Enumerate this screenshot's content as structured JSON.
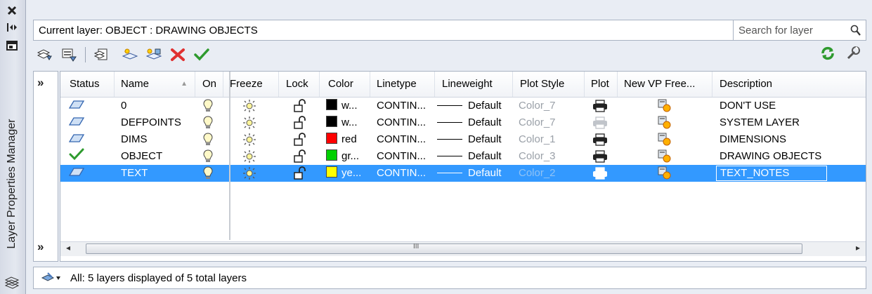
{
  "palette": {
    "title": "Layer Properties Manager"
  },
  "header": {
    "current_layer": "Current layer: OBJECT : DRAWING OBJECTS",
    "search_placeholder": "Search for layer"
  },
  "tree": {
    "expand_glyph": "»",
    "expand_glyph_bottom": "»"
  },
  "columns": [
    "Status",
    "Name",
    "On",
    "Freeze",
    "Lock",
    "Color",
    "Linetype",
    "Lineweight",
    "Plot Style",
    "Plot",
    "New VP Free...",
    "Description"
  ],
  "layers": [
    {
      "name": "0",
      "color_label": "w...",
      "color_hex": "#000000",
      "linetype": "CONTIN...",
      "lineweight": "Default",
      "plot_style": "Color_7",
      "description": "DON'T USE",
      "status": "layer",
      "plot_enabled": true
    },
    {
      "name": "DEFPOINTS",
      "color_label": "w...",
      "color_hex": "#000000",
      "linetype": "CONTIN...",
      "lineweight": "Default",
      "plot_style": "Color_7",
      "description": "SYSTEM LAYER",
      "status": "layer",
      "plot_enabled": false
    },
    {
      "name": "DIMS",
      "color_label": "red",
      "color_hex": "#ff0000",
      "linetype": "CONTIN...",
      "lineweight": "Default",
      "plot_style": "Color_1",
      "description": "DIMENSIONS",
      "status": "layer",
      "plot_enabled": true
    },
    {
      "name": "OBJECT",
      "color_label": "gr...",
      "color_hex": "#00d000",
      "linetype": "CONTIN...",
      "lineweight": "Default",
      "plot_style": "Color_3",
      "description": "DRAWING OBJECTS",
      "status": "current",
      "plot_enabled": true
    },
    {
      "name": "TEXT",
      "color_label": "ye...",
      "color_hex": "#ffff00",
      "linetype": "CONTIN...",
      "lineweight": "Default",
      "plot_style": "Color_2",
      "description": "TEXT_NOTES",
      "status": "layer",
      "plot_enabled": true,
      "selected": true
    }
  ],
  "scrollbar": {
    "thumb_glyph": "III"
  },
  "status_bar": {
    "text": "All: 5 layers displayed of 5 total layers"
  },
  "colors": {
    "selection": "#3399ff",
    "accent_green": "#2e9a2e",
    "delete_red": "#e03030"
  }
}
